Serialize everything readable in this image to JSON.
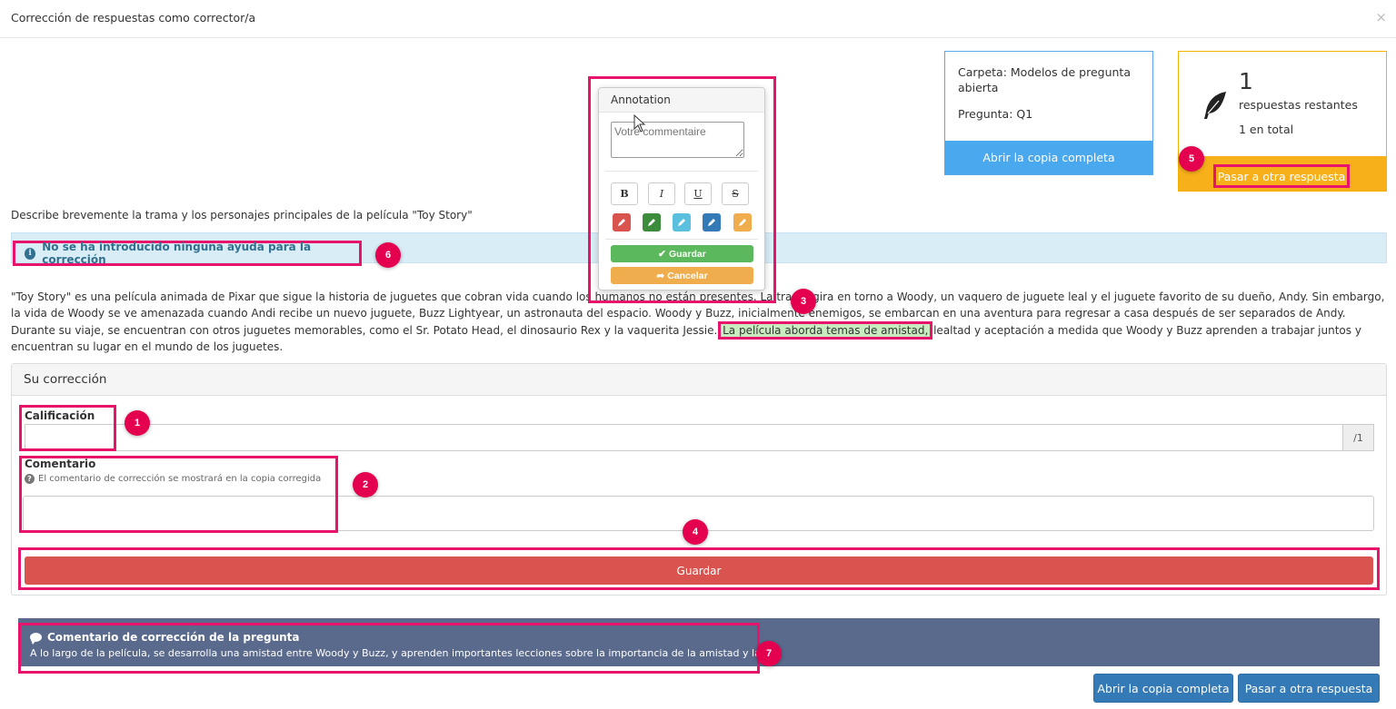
{
  "modal": {
    "title": "Corrección de respuestas como corrector/a",
    "close": "×"
  },
  "info_card": {
    "folder": "Carpeta: Modelos de pregunta abierta",
    "question": "Pregunta: Q1",
    "open_copy": "Abrir la copia completa"
  },
  "remaining": {
    "count": "1",
    "label": "respuestas restantes",
    "total": "1 en total",
    "next_button": "Pasar a otra respuesta"
  },
  "question_text": "Describe brevemente la trama y los personajes principales de la película \"Toy Story\"",
  "alert": {
    "text": "No se ha introducido ninguna ayuda para la corrección"
  },
  "answer": {
    "before": "\"Toy Story\" es una película animada de Pixar que sigue la historia de juguetes que cobran vida cuando los humanos no están presentes. La trama gira en torno a Woody, un vaquero de juguete leal y el juguete favorito de su dueño, Andy. Sin embargo, la vida de Woody se ve amenazada cuando Andi recibe un nuevo juguete, Buzz Lightyear, un astronauta del espacio. Woody y Buzz, inicialmente enemigos, se embarcan en una aventura para regresar a casa después de ser separados de Andy. Durante su viaje, se encuentran con otros juguetes memorables, como el Sr. Potato Head, el dinosaurio Rex y la vaquerita Jessie. ",
    "highlight": "La película aborda temas de amistad,",
    "after": " lealtad y aceptación a medida que Woody y Buzz aprenden a trabajar juntos y encuentran su lugar en el mundo de los juguetes."
  },
  "correction": {
    "title": "Su corrección",
    "grade_label": "Calificación",
    "grade_value": "",
    "grade_max": "/1",
    "comment_label": "Comentario",
    "comment_hint": "El comentario de corrección se mostrará en la copia corregida",
    "comment_value": "",
    "save": "Guardar"
  },
  "question_comment": {
    "title": "Comentario de corrección de la pregunta",
    "text": "A lo largo de la película, se desarrolla una amistad entre Woody y Buzz, y aprenden importantes lecciones sobre la importancia de la amistad y la..."
  },
  "bottom_buttons": {
    "open_copy": "Abrir la copia completa",
    "next": "Pasar a otra respuesta"
  },
  "annotation": {
    "title": "Annotation",
    "placeholder": "Votre commentaire",
    "format": {
      "bold": "B",
      "italic": "I",
      "underline": "U",
      "strike": "S"
    },
    "pens": [
      {
        "name": "red",
        "color": "#d9534f"
      },
      {
        "name": "green",
        "color": "#3c8c3c"
      },
      {
        "name": "cyan",
        "color": "#5bc0de"
      },
      {
        "name": "blue",
        "color": "#337ab7"
      },
      {
        "name": "orange",
        "color": "#f0ad4e"
      }
    ],
    "save": "Guardar",
    "cancel": "Cancelar"
  },
  "markers": [
    "1",
    "2",
    "3",
    "4",
    "5",
    "6",
    "7"
  ],
  "colors": {
    "accent_pink": "#e8136a",
    "info_blue": "#4aa8ef",
    "warning_orange": "#f7b01a",
    "danger_red": "#d9534f",
    "primary_blue": "#337ab7",
    "alert_bg": "#d9edf7",
    "comment_bg": "#5a6a8c",
    "success_green": "#5cb85c"
  }
}
